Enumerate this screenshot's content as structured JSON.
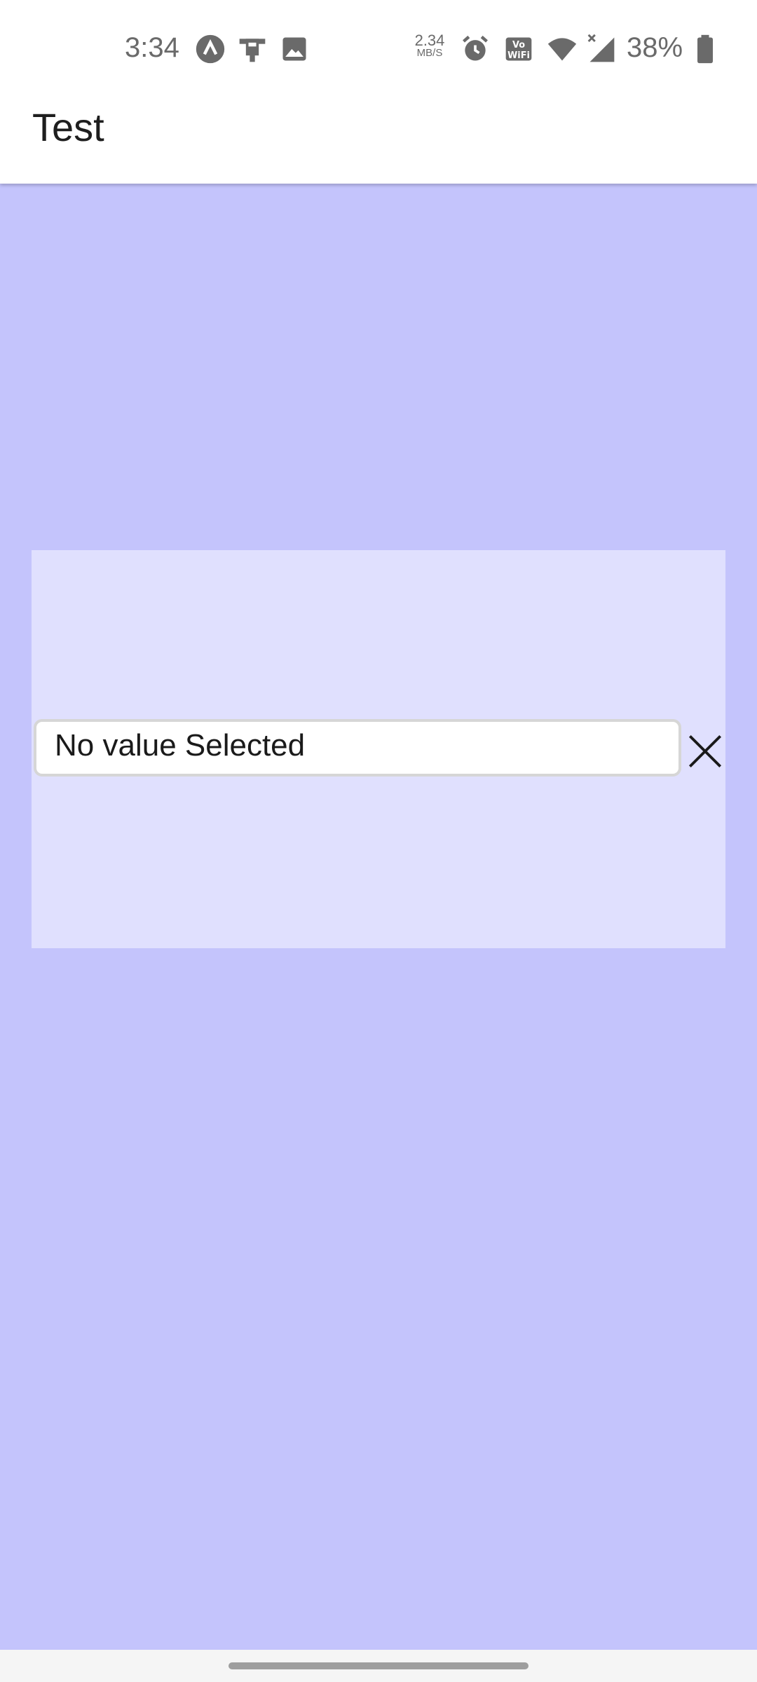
{
  "status_bar": {
    "time": "3:34",
    "speed_value": "2.34",
    "speed_unit": "MB/S",
    "battery_percent": "38%",
    "icons": [
      "app-notification-icon",
      "cast-icon",
      "image-icon",
      "alarm-icon",
      "vowifi-icon",
      "wifi-icon",
      "signal-icon",
      "battery-icon"
    ]
  },
  "app_bar": {
    "title": "Test"
  },
  "card": {
    "value_field_text": "No value Selected",
    "clear_icon": "close-icon"
  },
  "colors": {
    "background": "#c4c4fc",
    "card": "#e0e0fe",
    "app_bar": "#ffffff"
  }
}
